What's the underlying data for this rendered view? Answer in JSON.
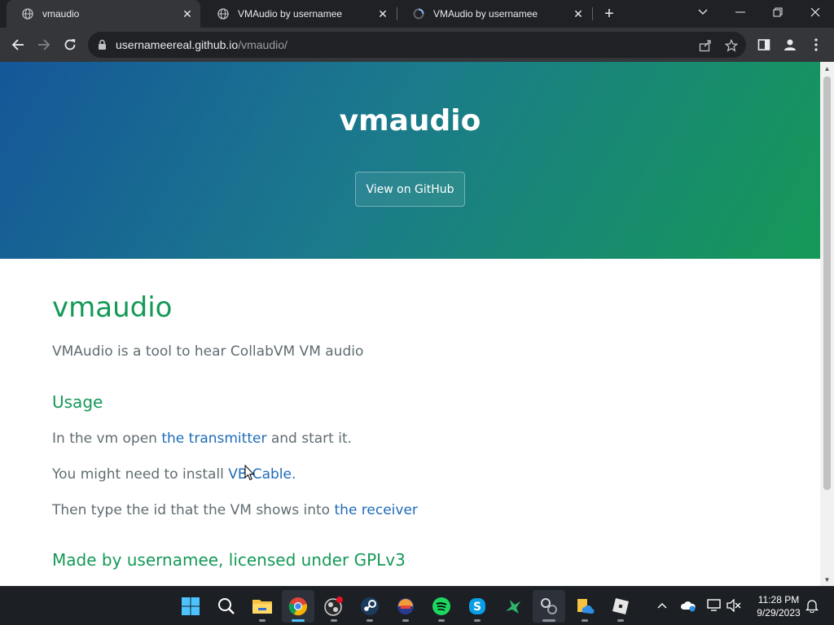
{
  "browser": {
    "tabs": [
      {
        "title": "vmaudio",
        "active": true
      },
      {
        "title": "VMAudio by usernamee",
        "active": false
      },
      {
        "title": "VMAudio by usernamee",
        "active": false
      }
    ],
    "url_host": "usernameereal.github.io",
    "url_path": "/vmaudio/"
  },
  "page": {
    "hero_title": "vmaudio",
    "github_button": "View on GitHub",
    "heading": "vmaudio",
    "intro": "VMAudio is a tool to hear CollabVM VM audio",
    "usage_heading": "Usage",
    "step1": {
      "before": "In the vm open ",
      "link": "the transmitter",
      "after": " and start it."
    },
    "step2": {
      "before": "You might need to install ",
      "link": "VB-Cable."
    },
    "step3": {
      "before": "Then type the id that the VM shows into ",
      "link": "the receiver"
    },
    "footer_heading": "Made by usernamee, licensed under GPLv3"
  },
  "colors": {
    "hero_start": "#155799",
    "hero_end": "#159957",
    "heading_green": "#159957",
    "link_blue": "#1e6bb8",
    "body_text": "#606c71"
  },
  "taskbar": {
    "apps": [
      "windows-start-icon",
      "search-icon",
      "file-explorer-icon",
      "chrome-icon",
      "obs-icon",
      "steam-icon",
      "app-icon",
      "spotify-icon",
      "skype-icon",
      "bird-app-icon",
      "network-app-icon",
      "files-cloud-icon",
      "roblox-icon"
    ],
    "time": "11:28 PM",
    "date": "9/29/2023"
  }
}
